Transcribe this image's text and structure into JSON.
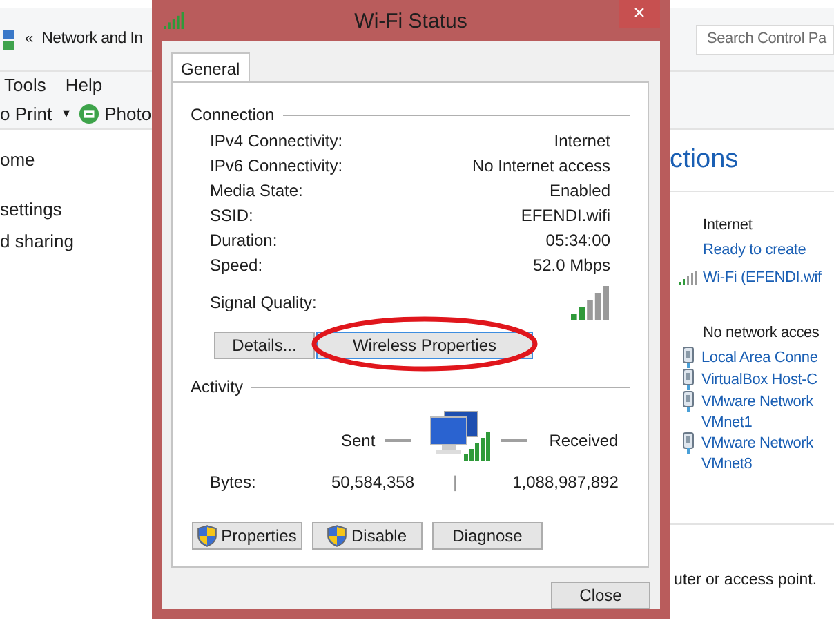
{
  "explorer": {
    "address_bar": {
      "back": "«",
      "path": "Network and In"
    },
    "search": {
      "placeholder": "Search Control Pa"
    },
    "menu": [
      "Tools",
      "Help"
    ],
    "toolbar": {
      "print": "o Print",
      "caret": "▾",
      "photo": "Photo"
    },
    "nav_items": [
      "ome",
      "settings",
      "d sharing"
    ],
    "heading": "ctions",
    "active_network": {
      "name": "Internet",
      "access": "Ready to create",
      "connection": "Wi-Fi (EFENDI.wif"
    },
    "other_network": {
      "name": "No network acces",
      "connections": [
        {
          "lines": [
            "Local Area Conne"
          ]
        },
        {
          "lines": [
            "VirtualBox Host-C"
          ]
        },
        {
          "lines": [
            "VMware Network",
            "VMnet1"
          ]
        },
        {
          "lines": [
            "VMware Network",
            "VMnet8"
          ]
        }
      ]
    },
    "footer_text": "uter or access point."
  },
  "dialog": {
    "title": "Wi-Fi Status",
    "close": "×",
    "tabs": [
      {
        "label": "General",
        "selected": true
      }
    ],
    "connection": {
      "title": "Connection",
      "rows": [
        {
          "label": "IPv4 Connectivity:",
          "value": "Internet"
        },
        {
          "label": "IPv6 Connectivity:",
          "value": "No Internet access"
        },
        {
          "label": "Media State:",
          "value": "Enabled"
        },
        {
          "label": "SSID:",
          "value": "EFENDI.wifi"
        },
        {
          "label": "Duration:",
          "value": "05:34:00"
        },
        {
          "label": "Speed:",
          "value": "52.0 Mbps"
        }
      ],
      "signal_label": "Signal Quality:",
      "buttons": [
        {
          "label": "Details...",
          "focused": false,
          "circled": false
        },
        {
          "label": "Wireless Properties",
          "focused": true,
          "circled": true
        }
      ]
    },
    "activity": {
      "title": "Activity",
      "sent": "Sent",
      "received": "Received",
      "bytes_label": "Bytes:",
      "bytes_sent": "50,584,358",
      "separator": "|",
      "bytes_received": "1,088,987,892"
    },
    "action_buttons": [
      {
        "label": "Properties",
        "kind": "shield"
      },
      {
        "label": "Disable",
        "kind": "shield"
      },
      {
        "label": "Diagnose",
        "kind": "plain"
      }
    ],
    "close_button": "Close"
  }
}
